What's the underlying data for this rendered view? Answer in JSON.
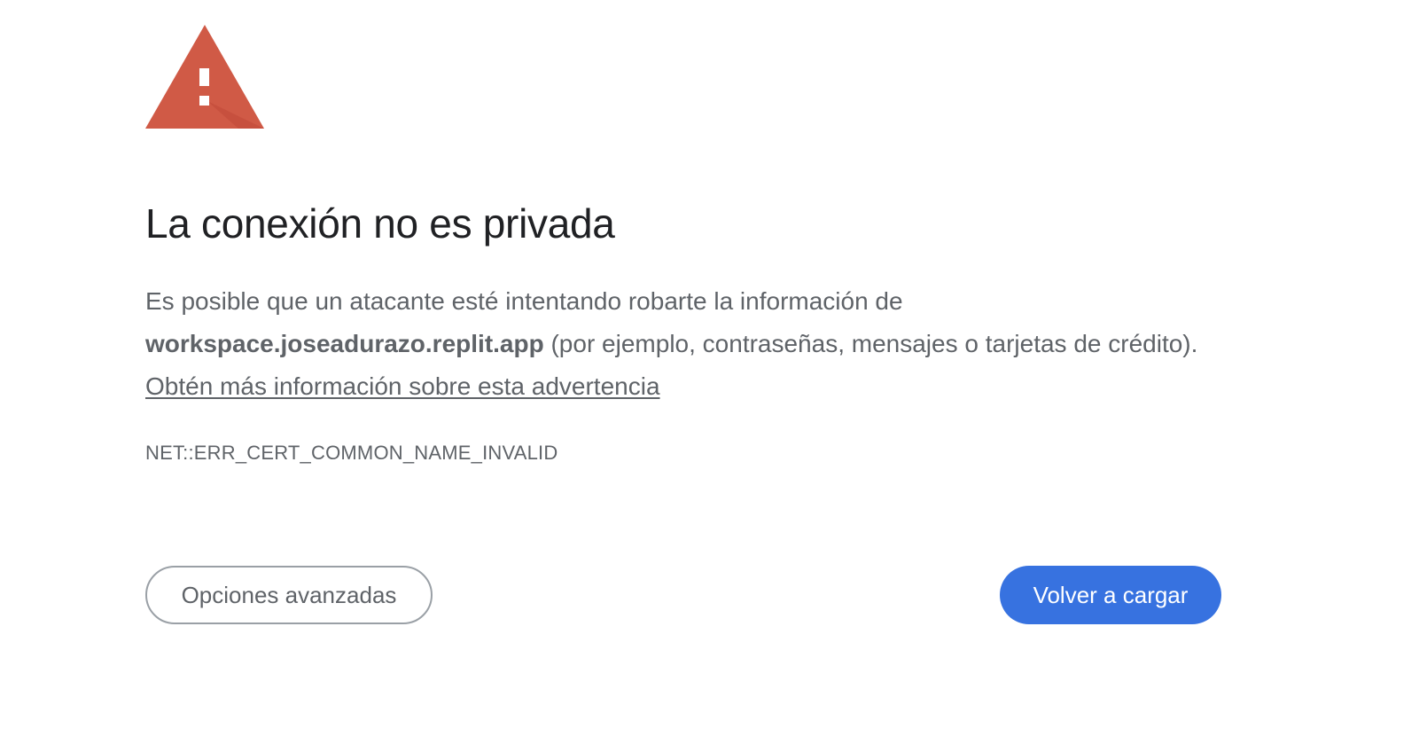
{
  "icons": {
    "warning": "warning-triangle-icon",
    "warning_color": "#d05a46"
  },
  "page": {
    "title": "La conexión no es privada",
    "message_intro": "Es posible que un atacante esté intentando robarte la información de ",
    "host": "workspace.joseadurazo.replit.app",
    "message_examples": " (por ejemplo, contraseñas, mensajes o tarjetas de crédito). ",
    "learn_more_link": "Obtén más información sobre esta advertencia",
    "error_code": "NET::ERR_CERT_COMMON_NAME_INVALID"
  },
  "buttons": {
    "advanced_label": "Opciones avanzadas",
    "reload_label": "Volver a cargar",
    "reload_color": "#3772e0"
  }
}
